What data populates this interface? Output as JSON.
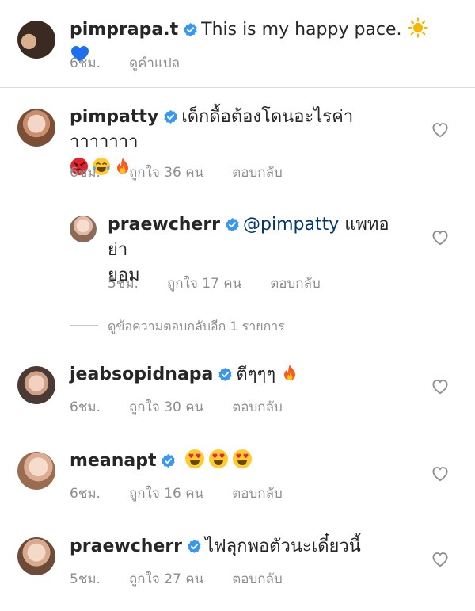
{
  "caption": {
    "username": "pimprapa.t",
    "text": "This is my happy pace.",
    "time": "6ชม.",
    "translate": "ดูคำแปล"
  },
  "comments": [
    {
      "username": "pimpatty",
      "text_line1": "เด็กดื้อต้องโดนอะไรค่าาาาาาาา",
      "time": "6ชม.",
      "likes": "ถูกใจ 36 คน",
      "reply": "ตอบกลับ"
    },
    {
      "username": "praewcherr",
      "mention": "@pimpatty",
      "text_after_mention": " แพทอย่า",
      "text_line2": "ยอม",
      "time": "5ชม.",
      "likes": "ถูกใจ 17 คน",
      "reply": "ตอบกลับ"
    },
    {
      "username": "jeabsopidnapa",
      "text": "ตีๆๆๆ",
      "time": "6ชม.",
      "likes": "ถูกใจ 30 คน",
      "reply": "ตอบกลับ"
    },
    {
      "username": "meanapt",
      "time": "6ชม.",
      "likes": "ถูกใจ 16 คน",
      "reply": "ตอบกลับ"
    },
    {
      "username": "praewcherr",
      "text": "ไฟลุกพอตัวนะเดี๋ยวนี้",
      "time": "5ชม.",
      "likes": "ถูกใจ 27 คน",
      "reply": "ตอบกลับ"
    }
  ],
  "view_replies": "ดูข้อความตอบกลับอีก 1 รายการ",
  "icons": {
    "verified": "verified-badge-icon",
    "like": "heart-outline-icon",
    "sun": "sun-emoji",
    "blue_heart": "blue-heart-emoji",
    "angry": "angry-face-emoji",
    "laughing": "tears-of-joy-emoji",
    "fire": "fire-emoji",
    "heart_eyes": "heart-eyes-emoji"
  },
  "colors": {
    "text": "#262626",
    "secondary": "#8e8e8e",
    "verified": "#3897f0",
    "mention": "#00376b"
  }
}
